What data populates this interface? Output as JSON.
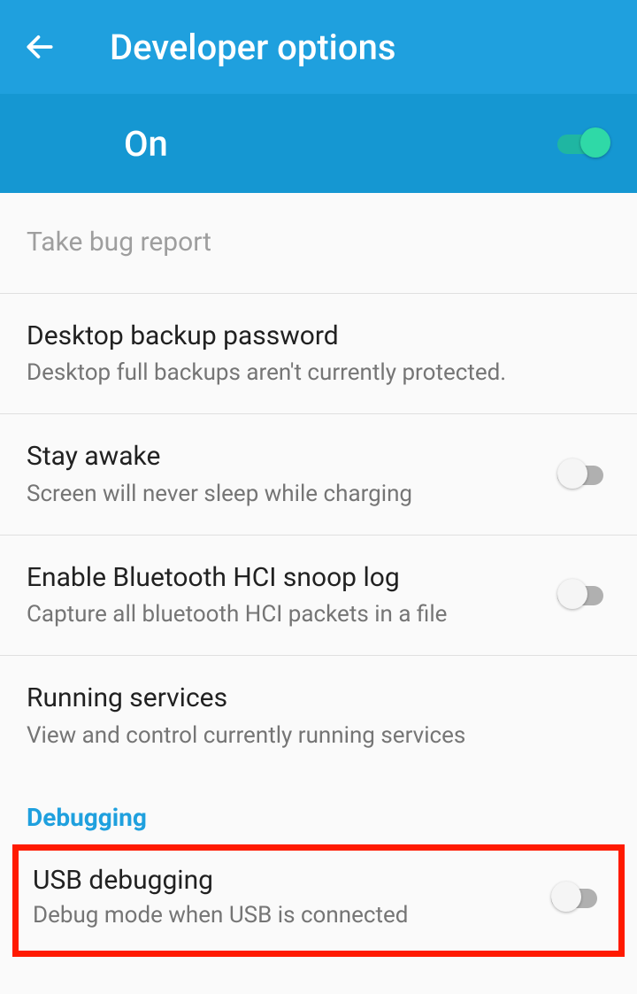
{
  "appbar": {
    "title": "Developer options"
  },
  "master": {
    "label": "On",
    "on": true
  },
  "items": [
    {
      "title": "Take bug report",
      "sub": "",
      "disabled": true,
      "toggle": null
    },
    {
      "title": "Desktop backup password",
      "sub": "Desktop full backups aren't currently protected.",
      "disabled": false,
      "toggle": null
    },
    {
      "title": "Stay awake",
      "sub": "Screen will never sleep while charging",
      "disabled": false,
      "toggle": false
    },
    {
      "title": "Enable Bluetooth HCI snoop log",
      "sub": "Capture all bluetooth HCI packets in a file",
      "disabled": false,
      "toggle": false
    },
    {
      "title": "Running services",
      "sub": "View and control currently running services",
      "disabled": false,
      "toggle": null
    }
  ],
  "section": {
    "debugging": "Debugging"
  },
  "usb": {
    "title": "USB debugging",
    "sub": "Debug mode when USB is connected",
    "toggle": false
  }
}
